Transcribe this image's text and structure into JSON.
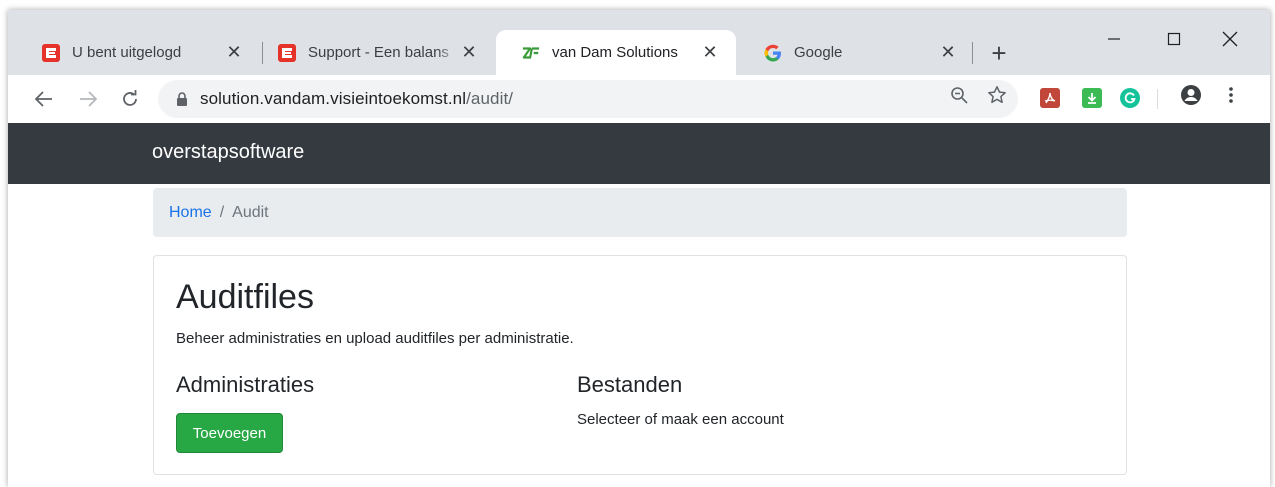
{
  "browser": {
    "tabs": [
      {
        "title": "U bent uitgelogd",
        "favicon": "e-red-icon",
        "active": false
      },
      {
        "title": "Support - Een balans",
        "favicon": "e-red-icon",
        "active": false
      },
      {
        "title": "van Dam Solutions",
        "favicon": "zf-icon",
        "active": true
      },
      {
        "title": "Google",
        "favicon": "google-g-icon",
        "active": false
      }
    ],
    "tab_close_glyph": "✕",
    "new_tab_glyph": "+",
    "window_controls": {
      "minimize": "–",
      "maximize": "☐",
      "close": "✕"
    },
    "url_host": "solution.vandam.visieintoekomst.nl",
    "url_path": "/audit/",
    "accent": "#1a73e8"
  },
  "site": {
    "brand": "overstapsoftware",
    "navbar_color": "#343a40",
    "breadcrumb": {
      "home": "Home",
      "separator": "/",
      "current": "Audit"
    },
    "page_title": "Auditfiles",
    "description": "Beheer administraties en upload auditfiles per administratie.",
    "left_heading": "Administraties",
    "add_button": "Toevoegen",
    "add_button_color": "#28a745",
    "right_heading": "Bestanden",
    "right_empty_text": "Selecteer of maak een account"
  }
}
